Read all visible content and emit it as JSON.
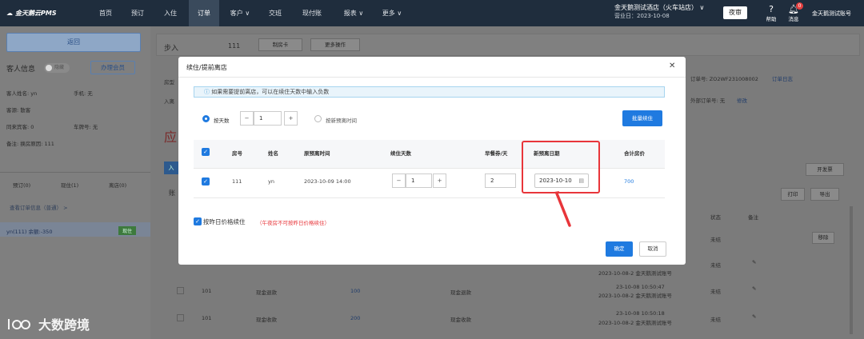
{
  "nav": {
    "logo": "金天鹅云PMS",
    "items": [
      "首页",
      "预订",
      "入住",
      "订单",
      "客户 ∨",
      "交班",
      "现付账",
      "报表 ∨",
      "更多 ∨"
    ],
    "hotel_name": "金天鹅测试酒店（火车站店） ∨",
    "business_day": "营业日：2023-10-08",
    "night_audit": "夜审",
    "help": "帮助",
    "messages": "消息",
    "message_count": "0",
    "account": "金天鹅测试账号"
  },
  "left": {
    "back": "返回",
    "guest_info": "客人信息",
    "toggle": "隐藏",
    "member_btn": "办理会员",
    "guest_name": "客人姓名: yn",
    "phone": "手机: 无",
    "source": "客源: 散客",
    "companions": "同来宾客: 0",
    "plate": "车牌号: 无",
    "remark": "备注: 换房原因: 111",
    "tabs": [
      "预订(0)",
      "现住(1)",
      "离店(0)"
    ],
    "order_link": "查看订单信息（普通） >",
    "room_entry": "yn(111)  余额:-350",
    "room_status": "现住"
  },
  "bg": {
    "step": "步入",
    "room": "111",
    "make_card": "制房卡",
    "more_ops": "更多操作",
    "room_type": "房型",
    "checkin": "入离",
    "order_no": "订单号: ZO2WF231008002",
    "order_log": "订单日志",
    "ext_order": "外部订单号: 无",
    "edit": "修改",
    "due": "应",
    "enter": "入",
    "bill": "账",
    "open_invoice": "开发票",
    "print": "打印",
    "export": "导出",
    "col_status": "状态",
    "col_remark": "备注",
    "unsettled": "未结",
    "move": "移除",
    "rows": [
      {
        "room": "101",
        "type": "现金退款",
        "amount": "100",
        "method": "现金退款",
        "time": "23-10-08 10:50:47",
        "op": "2023-10-08-2 金天鹅测试账号"
      },
      {
        "room": "101",
        "type": "现金收款",
        "amount": "200",
        "method": "现金收款",
        "time": "23-10-08 10:50:18",
        "op": "2023-10-08-2 金天鹅测试账号"
      }
    ],
    "row_top_op": "2023-10-08-2 金天鹅测试账号",
    "row_mid_op": "2023-10-08-2 金天鹅测试账号"
  },
  "modal": {
    "title": "续住/提前离店",
    "info": "如果需要提前离店，可以在续住天数中输入负数",
    "by_days": "按天数",
    "days_value": "1",
    "by_date": "按新预离时间",
    "batch_btn": "批量续住",
    "columns": [
      "房号",
      "姓名",
      "原预离时间",
      "续住天数",
      "早餐券/天",
      "新预离日期",
      "合计房价"
    ],
    "row": {
      "room": "111",
      "name": "yn",
      "orig_departure": "2023-10-09 14:00",
      "extend_days": "1",
      "breakfast": "2",
      "new_date": "2023-10-10",
      "total": "700"
    },
    "yesterday_price": "按昨日价格续住",
    "yesterday_note": "（午夜房不可按昨日价格续住）",
    "confirm": "确定",
    "cancel": "取消"
  },
  "watermark": "大数跨境",
  "colors": {
    "primary": "#1f7ae0",
    "highlight": "#e8353a",
    "nav": "#1f2d3d"
  }
}
